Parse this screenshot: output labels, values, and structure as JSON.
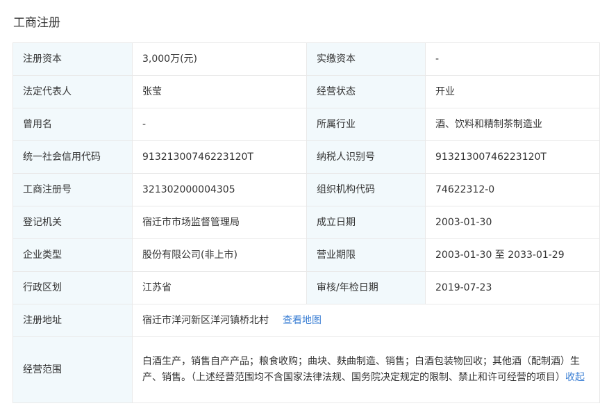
{
  "section_title": "工商注册",
  "rows": [
    {
      "l1": "注册资本",
      "v1": "3,000万(元)",
      "l2": "实缴资本",
      "v2": "-"
    },
    {
      "l1": "法定代表人",
      "v1": "张莹",
      "l2": "经营状态",
      "v2": "开业"
    },
    {
      "l1": "曾用名",
      "v1": "-",
      "l2": "所属行业",
      "v2": "酒、饮料和精制茶制造业"
    },
    {
      "l1": "统一社会信用代码",
      "v1": "91321300746223120T",
      "l2": "纳税人识别号",
      "v2": "91321300746223120T"
    },
    {
      "l1": "工商注册号",
      "v1": "321302000004305",
      "l2": "组织机构代码",
      "v2": "74622312-0"
    },
    {
      "l1": "登记机关",
      "v1": "宿迁市市场监督管理局",
      "l2": "成立日期",
      "v2": "2003-01-30"
    },
    {
      "l1": "企业类型",
      "v1": "股份有限公司(非上市)",
      "l2": "营业期限",
      "v2": "2003-01-30 至 2033-01-29"
    },
    {
      "l1": "行政区划",
      "v1": "江苏省",
      "l2": "审核/年检日期",
      "v2": "2019-07-23"
    }
  ],
  "address": {
    "label": "注册地址",
    "value": "宿迁市洋河新区洋河镇桥北村",
    "map_link": "查看地图"
  },
  "scope": {
    "label": "经营范围",
    "value": "白酒生产，销售自产产品；粮食收购；曲块、麸曲制造、销售；白酒包装物回收；其他酒（配制酒）生产、销售。（上述经营范围均不含国家法律法规、国务院决定规定的限制、禁止和许可经营的项目）",
    "collapse_link": "收起"
  },
  "colors": {
    "label_bg": "#f2f9fc",
    "border": "#e9e9e9",
    "link": "#3b7fd4"
  }
}
